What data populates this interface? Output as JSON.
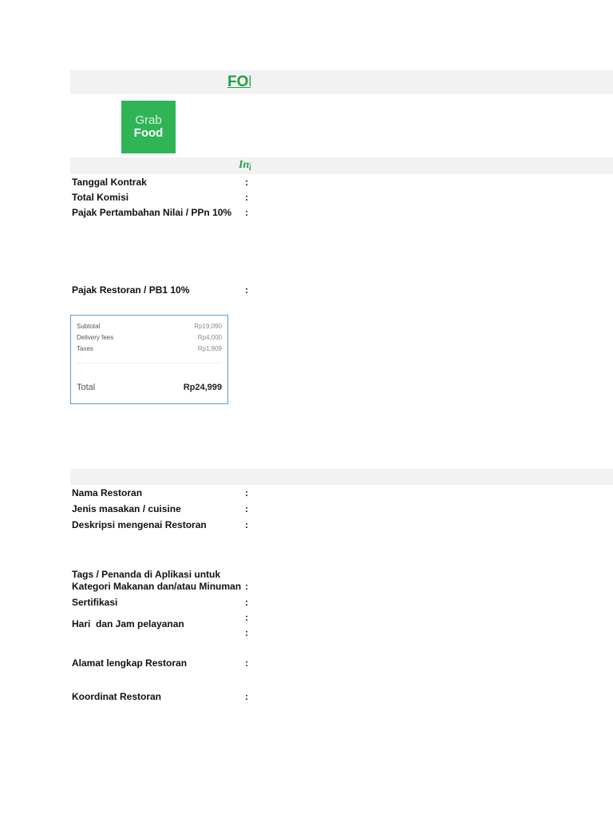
{
  "header": {
    "title": "FORMULIR",
    "subtitle": "Informasi"
  },
  "logo": {
    "line1": "Grab",
    "line2": "Food"
  },
  "contract": [
    {
      "label": "Tanggal Kontrak",
      "sep": ":"
    },
    {
      "label": "Total Komisi",
      "sep": ":"
    },
    {
      "label": "Pajak Pertambahan Nilai / PPn 10%",
      "sep": ":"
    },
    {
      "label": "Pajak Restoran / PB1 10%",
      "sep": ":"
    }
  ],
  "receipt": {
    "rows": [
      {
        "label": "Subtotal",
        "value": "Rp19,090"
      },
      {
        "label": "Delivery fees",
        "value": "Rp4,000"
      },
      {
        "label": "Taxes",
        "value": "Rp1,909"
      }
    ],
    "total_label": "Total",
    "total_value": "Rp24,999"
  },
  "restaurant": [
    {
      "label": "Nama Restoran",
      "sep": ":"
    },
    {
      "label": "Jenis masakan / cuisine",
      "sep": ":"
    },
    {
      "label": "Deskripsi mengenai Restoran",
      "sep": ":"
    },
    {
      "label": "Tags / Penanda di Aplikasi untuk Kategori Makanan dan/atau Minuman",
      "sep": ":"
    },
    {
      "label": "Sertifikasi",
      "sep": ":"
    },
    {
      "label": "Hari  dan Jam pelayanan",
      "sep": ":"
    },
    {
      "label": "Alamat lengkap Restoran",
      "sep": ":"
    },
    {
      "label": "Koordinat Restoran",
      "sep": ":"
    }
  ],
  "extra_sep": ":"
}
